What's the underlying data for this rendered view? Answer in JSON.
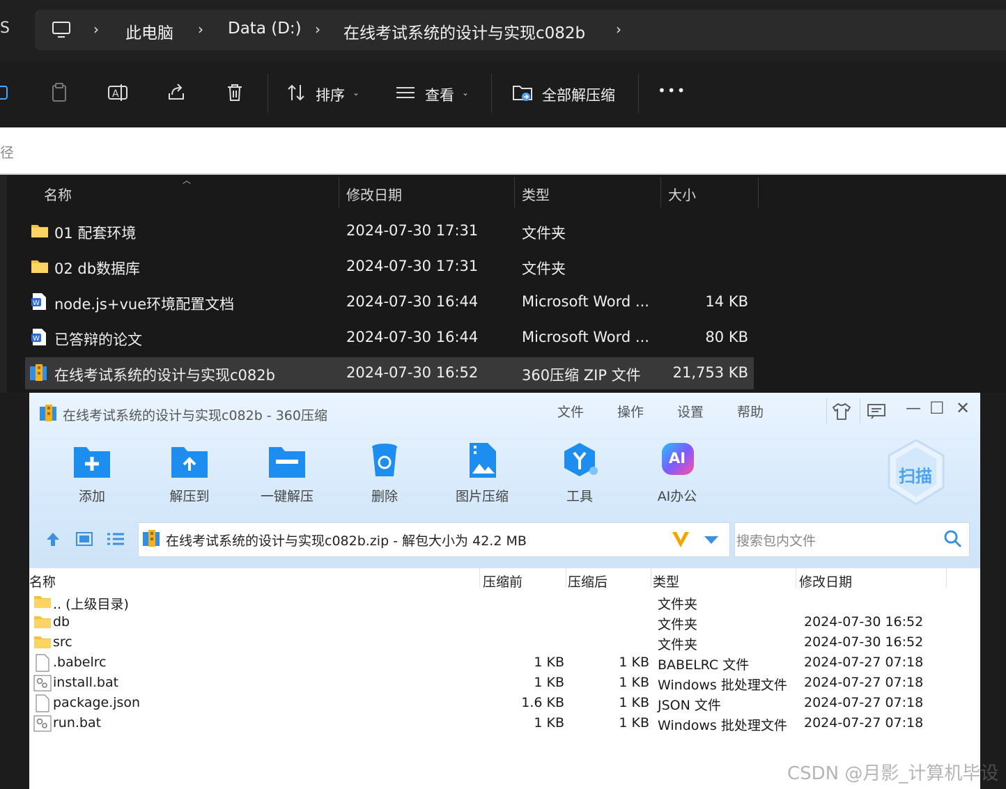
{
  "explorer": {
    "address_left_fragment": "S",
    "breadcrumb": [
      "此电脑",
      "Data (D:)",
      "在线考试系统的设计与实现c082b"
    ],
    "toolbar": {
      "sort_label": "排序",
      "view_label": "查看",
      "extract_all_label": "全部解压缩",
      "more_label": "•••"
    },
    "search_fragment": "径",
    "columns": [
      "名称",
      "修改日期",
      "类型",
      "大小"
    ],
    "files": [
      {
        "name": "01 配套环境",
        "date": "2024-07-30 17:31",
        "type": "文件夹",
        "size": "",
        "icon": "folder-icon"
      },
      {
        "name": "02 db数据库",
        "date": "2024-07-30 17:31",
        "type": "文件夹",
        "size": "",
        "icon": "folder-icon"
      },
      {
        "name": "node.js+vue环境配置文档",
        "date": "2024-07-30 16:44",
        "type": "Microsoft Word ...",
        "size": "14 KB",
        "icon": "word-doc-icon"
      },
      {
        "name": "已答辩的论文",
        "date": "2024-07-30 16:44",
        "type": "Microsoft Word ...",
        "size": "80 KB",
        "icon": "word-doc-icon"
      },
      {
        "name": "在线考试系统的设计与实现c082b",
        "date": "2024-07-30 16:52",
        "type": "360压缩 ZIP 文件",
        "size": "21,753 KB",
        "icon": "zip-archive-icon"
      }
    ]
  },
  "zip_window": {
    "title": "在线考试系统的设计与实现c082b - 360压缩",
    "menu": [
      "文件",
      "操作",
      "设置",
      "帮助"
    ],
    "tools": [
      "添加",
      "解压到",
      "一键解压",
      "删除",
      "图片压缩",
      "工具",
      "AI办公"
    ],
    "scan_label": "扫描",
    "ai_badge": "AI",
    "address_text": "在线考试系统的设计与实现c082b.zip - 解包大小为 42.2 MB",
    "search_placeholder": "搜索包内文件",
    "columns": [
      "名称",
      "压缩前",
      "压缩后",
      "类型",
      "修改日期"
    ],
    "rows": [
      {
        "name": ".. (上级目录)",
        "before": "",
        "after": "",
        "type": "文件夹",
        "date": "",
        "icon": "folder-icon"
      },
      {
        "name": "db",
        "before": "",
        "after": "",
        "type": "文件夹",
        "date": "2024-07-30 16:52",
        "icon": "folder-icon"
      },
      {
        "name": "src",
        "before": "",
        "after": "",
        "type": "文件夹",
        "date": "2024-07-30 16:52",
        "icon": "folder-icon"
      },
      {
        "name": ".babelrc",
        "before": "1 KB",
        "after": "1 KB",
        "type": "BABELRC 文件",
        "date": "2024-07-27 07:18",
        "icon": "file-icon"
      },
      {
        "name": "install.bat",
        "before": "1 KB",
        "after": "1 KB",
        "type": "Windows 批处理文件",
        "date": "2024-07-27 07:18",
        "icon": "batch-file-icon"
      },
      {
        "name": "package.json",
        "before": "1.6 KB",
        "after": "1 KB",
        "type": "JSON 文件",
        "date": "2024-07-27 07:18",
        "icon": "file-icon"
      },
      {
        "name": "run.bat",
        "before": "1 KB",
        "after": "1 KB",
        "type": "Windows 批处理文件",
        "date": "2024-07-27 07:18",
        "icon": "batch-file-icon"
      }
    ]
  },
  "watermark": "CSDN @月影_计算机毕设",
  "colors": {
    "explorer_bg": "#1c1c1c",
    "selected_row": "#393939",
    "folder": "#f3c13a",
    "zip_accent": "#1e8ef0",
    "zip_header_bg": "#d6e9fb"
  }
}
